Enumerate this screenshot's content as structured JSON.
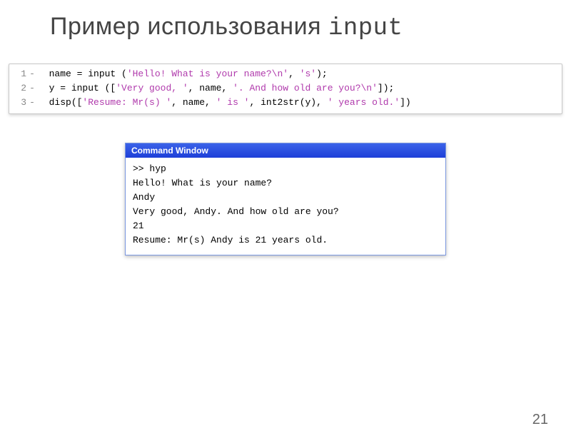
{
  "title_main": "Пример использования ",
  "title_mono": "input",
  "code": {
    "lines": [
      {
        "num": "1",
        "segments": [
          {
            "cls": "k-black",
            "t": "name = input ("
          },
          {
            "cls": "k-str",
            "t": "'Hello! What is your name?\\n'"
          },
          {
            "cls": "k-black",
            "t": ", "
          },
          {
            "cls": "k-str",
            "t": "'s'"
          },
          {
            "cls": "k-black",
            "t": ");"
          }
        ]
      },
      {
        "num": "2",
        "segments": [
          {
            "cls": "k-black",
            "t": "y = input (["
          },
          {
            "cls": "k-str",
            "t": "'Very good, '"
          },
          {
            "cls": "k-black",
            "t": ", name, "
          },
          {
            "cls": "k-str",
            "t": "'. And how old are you?\\n'"
          },
          {
            "cls": "k-black",
            "t": "]);"
          }
        ]
      },
      {
        "num": "3",
        "segments": [
          {
            "cls": "k-black",
            "t": "disp(["
          },
          {
            "cls": "k-str",
            "t": "'Resume: Mr(s) '"
          },
          {
            "cls": "k-black",
            "t": ", name, "
          },
          {
            "cls": "k-str",
            "t": "' is '"
          },
          {
            "cls": "k-black",
            "t": ", int2str(y), "
          },
          {
            "cls": "k-str",
            "t": "' years old.'"
          },
          {
            "cls": "k-black",
            "t": "])"
          }
        ]
      }
    ]
  },
  "command_window": {
    "title": "Command Window",
    "rows": [
      ">> hyp",
      "Hello! What is your name?",
      "Andy",
      "Very good, Andy. And how old are you?",
      "21",
      "Resume: Mr(s) Andy is 21 years old."
    ]
  },
  "page_number": "21"
}
